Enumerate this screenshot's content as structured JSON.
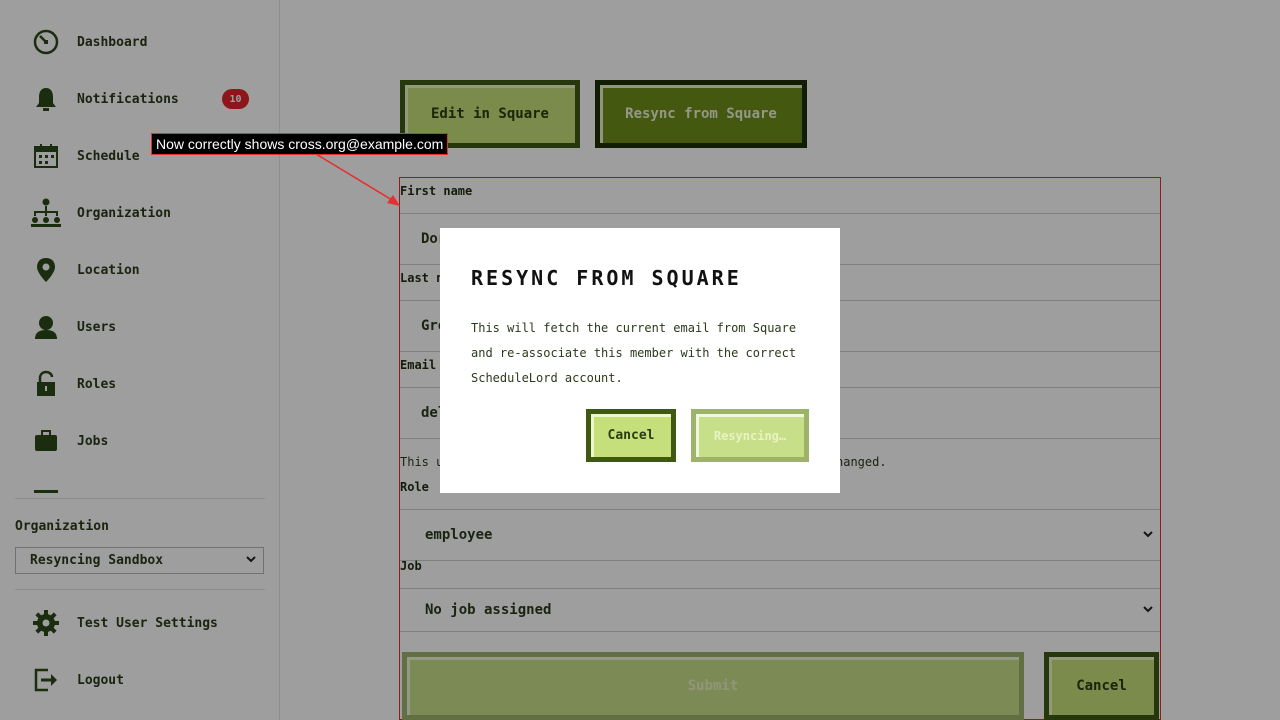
{
  "sidebar": {
    "items": [
      {
        "label": "Dashboard",
        "icon": "dashboard-icon"
      },
      {
        "label": "Notifications",
        "icon": "bell-icon",
        "badge": "10"
      },
      {
        "label": "Schedule",
        "icon": "calendar-icon"
      },
      {
        "label": "Organization",
        "icon": "org-chart-icon"
      },
      {
        "label": "Location",
        "icon": "location-pin-icon"
      },
      {
        "label": "Users",
        "icon": "user-icon"
      },
      {
        "label": "Roles",
        "icon": "unlock-icon"
      },
      {
        "label": "Jobs",
        "icon": "briefcase-icon"
      }
    ],
    "organization_label": "Organization",
    "organization_value": "Resyncing Sandbox",
    "footer": [
      {
        "label": "Test User Settings",
        "icon": "gear-icon"
      },
      {
        "label": "Logout",
        "icon": "logout-icon"
      }
    ]
  },
  "actions": {
    "edit_label": "Edit in Square",
    "resync_label": "Resync from Square"
  },
  "form": {
    "first_name_label": "First name",
    "first_name_value": "Dor",
    "last_name_label": "Last n",
    "last_name_value": "Gre",
    "email_label": "Email",
    "email_value": "del",
    "help_start": "This u",
    "help_end": "hanged.",
    "role_label": "Role",
    "role_value": "employee",
    "job_label": "Job",
    "job_value": "No job assigned",
    "submit_label": "Submit",
    "cancel_label": "Cancel"
  },
  "modal": {
    "title": "RESYNC FROM SQUARE",
    "body": "This will fetch the current email from Square and re-associate this member with the correct ScheduleLord account.",
    "cancel_label": "Cancel",
    "confirm_label": "Resyncing…"
  },
  "annotation": {
    "text": "Now correctly shows cross.org@example.com",
    "color": "#e53030"
  },
  "colors": {
    "accent_green": "#6f8f1a",
    "light_green": "#c5e07a",
    "dark_border": "#1f2f08",
    "badge_red": "#e5252a"
  }
}
